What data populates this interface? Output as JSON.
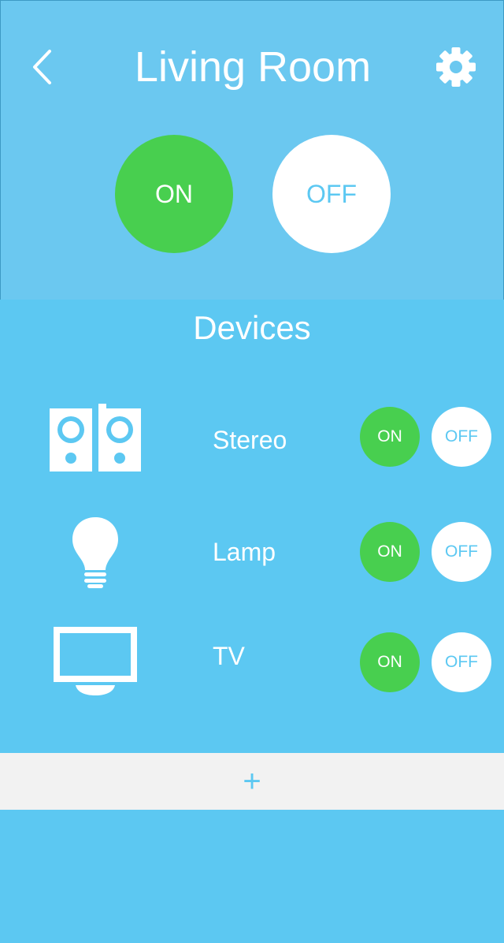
{
  "header": {
    "title": "Living Room",
    "back_icon": "chevron-left-icon",
    "settings_icon": "gear-icon",
    "master_on_label": "ON",
    "master_off_label": "OFF"
  },
  "devices": {
    "title": "Devices",
    "items": [
      {
        "label": "Stereo",
        "icon": "speakers-icon",
        "on_label": "ON",
        "off_label": "OFF"
      },
      {
        "label": "Lamp",
        "icon": "lightbulb-icon",
        "on_label": "ON",
        "off_label": "OFF"
      },
      {
        "label": "TV",
        "icon": "tv-icon",
        "on_label": "ON",
        "off_label": "OFF"
      }
    ]
  },
  "add_bar": {
    "label": "+"
  },
  "colors": {
    "header_bg": "#6bc8f0",
    "body_bg": "#5cc8f2",
    "on_green": "#48cf4f",
    "off_white": "#ffffff",
    "add_bar_bg": "#f2f2f2"
  }
}
